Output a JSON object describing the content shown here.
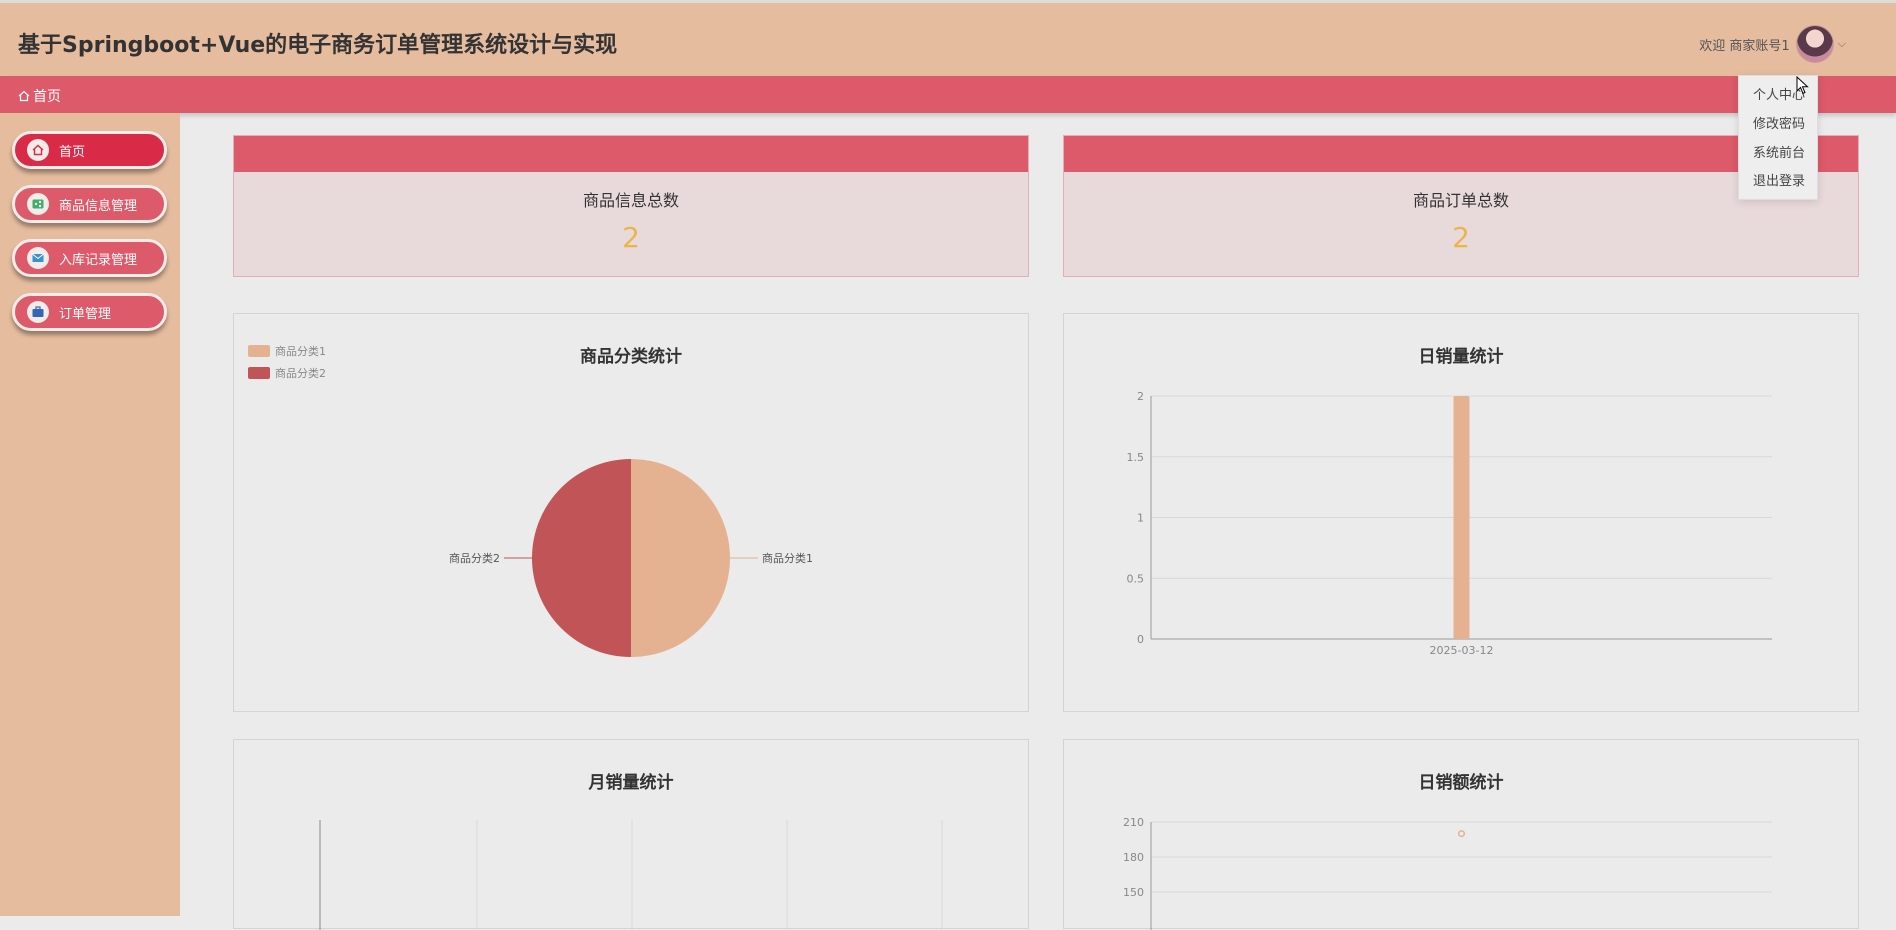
{
  "header": {
    "title": "基于Springboot+Vue的电子商务订单管理系统设计与实现",
    "welcome": "欢迎 商家账号1"
  },
  "breadcrumb": {
    "home": "首页"
  },
  "sidebar": {
    "items": [
      {
        "label": "首页",
        "icon": "home-icon"
      },
      {
        "label": "商品信息管理",
        "icon": "share-icon"
      },
      {
        "label": "入库记录管理",
        "icon": "mail-icon"
      },
      {
        "label": "订单管理",
        "icon": "briefcase-icon"
      }
    ]
  },
  "dropdown": {
    "items": [
      "个人中心",
      "修改密码",
      "系统前台",
      "退出登录"
    ]
  },
  "stats": [
    {
      "label": "商品信息总数",
      "value": "2"
    },
    {
      "label": "商品订单总数",
      "value": "2"
    }
  ],
  "colors": {
    "header_bg": "#e5bc9e",
    "accent": "#dc5a6a",
    "active": "#d92b48",
    "stat_value": "#eab64a",
    "pie_1": "#e5b291",
    "pie_2": "#c15456"
  },
  "chart_data": [
    {
      "type": "pie",
      "title": "商品分类统计",
      "legend_position": "top-left",
      "slices": [
        {
          "name": "商品分类1",
          "value": 1
        },
        {
          "name": "商品分类2",
          "value": 1
        }
      ]
    },
    {
      "type": "bar",
      "title": "日销量统计",
      "categories": [
        "2025-03-12"
      ],
      "values": [
        2
      ],
      "ylim": [
        0,
        2
      ],
      "yticks": [
        "2",
        "1.5",
        "1",
        "0.5",
        "0"
      ],
      "grid": true
    },
    {
      "type": "bar",
      "title": "月销量统计",
      "categories": [],
      "values": []
    },
    {
      "type": "scatter",
      "title": "日销额统计",
      "yticks": [
        "210",
        "180",
        "150"
      ],
      "values": [
        200
      ],
      "grid": true
    }
  ]
}
